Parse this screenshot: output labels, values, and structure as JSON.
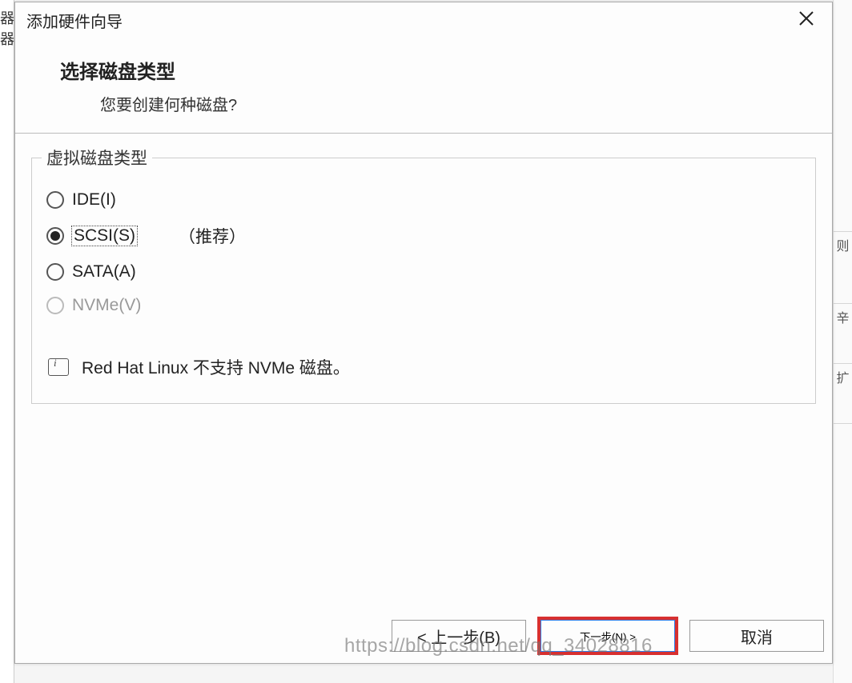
{
  "leftEdge": "器器",
  "dialog": {
    "title": "添加硬件向导",
    "headerTitle": "选择磁盘类型",
    "headerSubtitle": "您要创建何种磁盘?"
  },
  "fieldset": {
    "legend": "虚拟磁盘类型",
    "options": {
      "ide": "IDE(I)",
      "scsi": "SCSI(S)",
      "scsiRecommend": "（推荐）",
      "sata": "SATA(A)",
      "nvme": "NVMe(V)"
    },
    "infoText": "Red Hat Linux 不支持 NVMe 磁盘。"
  },
  "buttons": {
    "back": "< 上一步(B)",
    "next": "下一步(N) >",
    "cancel": "取消"
  },
  "watermark": "https://blog.csdn.net/qq_34028816",
  "rightEdge": {
    "a": "则",
    "b": "辛",
    "c": "扩"
  }
}
